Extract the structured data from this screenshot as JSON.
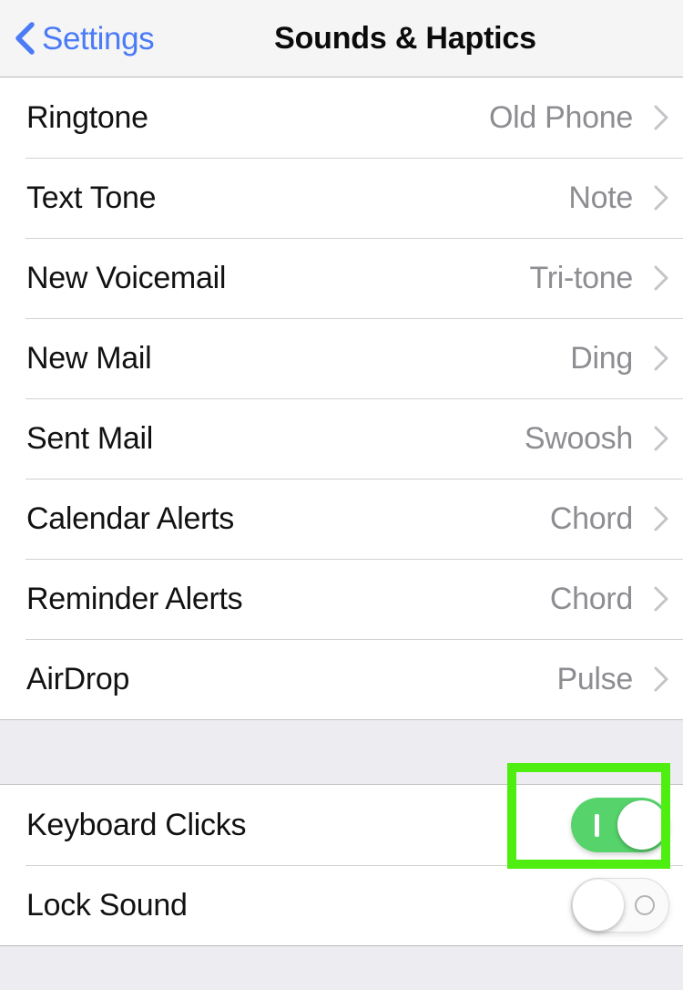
{
  "navbar": {
    "back_label": "Settings",
    "back_icon": "chevron-left-icon",
    "title": "Sounds & Haptics",
    "tint_color": "#4b7bf5",
    "background_color": "#f5f5f6"
  },
  "sound_group": {
    "rows": [
      {
        "label": "Ringtone",
        "value": "Old Phone",
        "accessory": "chevron-right-icon"
      },
      {
        "label": "Text Tone",
        "value": "Note",
        "accessory": "chevron-right-icon"
      },
      {
        "label": "New Voicemail",
        "value": "Tri-tone",
        "accessory": "chevron-right-icon"
      },
      {
        "label": "New Mail",
        "value": "Ding",
        "accessory": "chevron-right-icon"
      },
      {
        "label": "Sent Mail",
        "value": "Swoosh",
        "accessory": "chevron-right-icon"
      },
      {
        "label": "Calendar Alerts",
        "value": "Chord",
        "accessory": "chevron-right-icon"
      },
      {
        "label": "Reminder Alerts",
        "value": "Chord",
        "accessory": "chevron-right-icon"
      },
      {
        "label": "AirDrop",
        "value": "Pulse",
        "accessory": "chevron-right-icon"
      }
    ]
  },
  "switch_group": {
    "rows": [
      {
        "label": "Keyboard Clicks",
        "state": "on",
        "accessory": "toggle-switch"
      },
      {
        "label": "Lock Sound",
        "state": "off",
        "accessory": "toggle-switch"
      }
    ]
  },
  "annotation": {
    "target": "keyboard-clicks-switch",
    "color": "#4fee11"
  },
  "colors": {
    "switch_on": "#56d36b",
    "value_text": "#8d8d92",
    "label_text": "#121212",
    "separator": "#d2d2d4",
    "group_gap": "#ededf1"
  }
}
